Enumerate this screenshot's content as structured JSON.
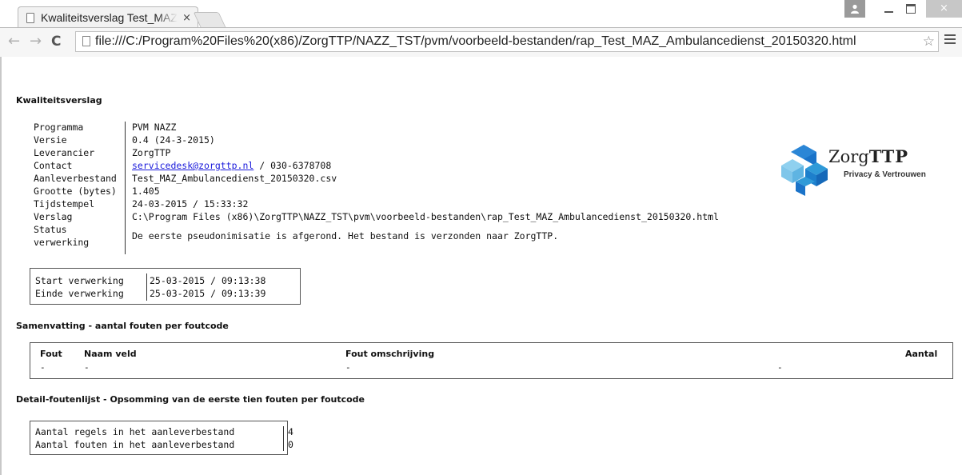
{
  "browser": {
    "tab_title": "Kwaliteitsverslag Test_MAZ_Ambulancedienst",
    "tab_close": "×",
    "url": "file:///C:/Program%20Files%20(x86)/ZorgTTP/NAZZ_TST/pvm/voorbeeld-bestanden/rap_Test_MAZ_Ambulancedienst_20150320.html",
    "window_close": "×",
    "back": "←",
    "forward": "→",
    "reload": "C",
    "star": "☆"
  },
  "report": {
    "title": "Kwaliteitsverslag",
    "info": [
      {
        "label": "Programma",
        "value": "PVM NAZZ"
      },
      {
        "label": "Versie",
        "value": "0.4 (24-3-2015)"
      },
      {
        "label": "Leverancier",
        "value": "ZorgTTP"
      },
      {
        "label": "Contact",
        "link": "servicedesk@zorgttp.nl",
        "value": " / 030-6378708"
      },
      {
        "label": "Aanleverbestand",
        "value": "Test_MAZ_Ambulancedienst_20150320.csv"
      },
      {
        "label": "Grootte (bytes)",
        "value": "1.405"
      },
      {
        "label": "Tijdstempel",
        "value": "24-03-2015 / 15:33:32"
      },
      {
        "label": "Verslag",
        "value": "C:\\Program Files (x86)\\ZorgTTP\\NAZZ_TST\\pvm\\voorbeeld-bestanden\\rap_Test_MAZ_Ambulancedienst_20150320.html"
      },
      {
        "label": "Status",
        "label2": "verwerking",
        "value": "De eerste pseudonimisatie is afgerond. Het bestand is verzonden naar ZorgTTP."
      }
    ],
    "logo": {
      "brand_light": "Zorg",
      "brand_bold": "TTP",
      "tagline": "Privacy & Vertrouwen"
    },
    "timing": [
      {
        "label": "Start verwerking",
        "value": "25-03-2015 / 09:13:38"
      },
      {
        "label": "Einde verwerking",
        "value": "25-03-2015 / 09:13:39"
      }
    ],
    "summary_title": "Samenvatting - aantal fouten per foutcode",
    "summary_headers": {
      "fout": "Fout",
      "naam": "Naam veld",
      "omschrijving": "Fout omschrijving",
      "aantal": "Aantal"
    },
    "summary_row": {
      "fout": "-",
      "naam": "-",
      "omschrijving": "-",
      "aantal": "-"
    },
    "detail_title": "Detail-foutenlijst - Opsomming van de eerste tien fouten per foutcode",
    "counts": [
      {
        "label": "Aantal regels in het aanleverbestand",
        "value": "4"
      },
      {
        "label": "Aantal fouten in het aanleverbestand",
        "value": "0"
      }
    ]
  },
  "colors": {
    "link": "#1a1adb",
    "logo_blue_dark": "#1a73c9",
    "logo_blue_mid": "#2f9ad8",
    "logo_blue_light": "#7fc6ea"
  }
}
